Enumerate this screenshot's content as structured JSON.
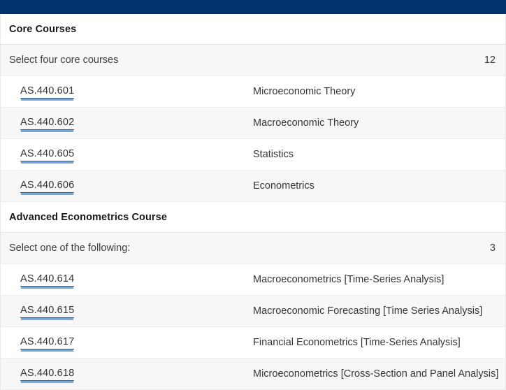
{
  "topbar": {
    "color": "#00326e"
  },
  "theme": {
    "navy": "#00326e",
    "link_underline": "#6fa8dd",
    "row_alt_bg": "#f7f7f7",
    "text": "#333333"
  },
  "sections": [
    {
      "header": "Core Courses",
      "comment": {
        "label": "Select four core courses",
        "hours": "12"
      },
      "courses": [
        {
          "code": "AS.440.601",
          "title": "Microeconomic Theory"
        },
        {
          "code": "AS.440.602",
          "title": "Macroeconomic Theory"
        },
        {
          "code": "AS.440.605",
          "title": "Statistics"
        },
        {
          "code": "AS.440.606",
          "title": "Econometrics"
        }
      ]
    },
    {
      "header": "Advanced Econometrics Course",
      "comment": {
        "label": "Select one of the following:",
        "hours": "3"
      },
      "courses": [
        {
          "code": "AS.440.614",
          "title": "Macroeconometrics [Time-Series Analysis]"
        },
        {
          "code": "AS.440.615",
          "title": "Macroeconomic Forecasting [Time Series Analysis]"
        },
        {
          "code": "AS.440.617",
          "title": "Financial Econometrics [Time-Series Analysis]"
        },
        {
          "code": "AS.440.618",
          "title": "Microeconometrics [Cross-Section and Panel Analysis]"
        }
      ]
    }
  ]
}
